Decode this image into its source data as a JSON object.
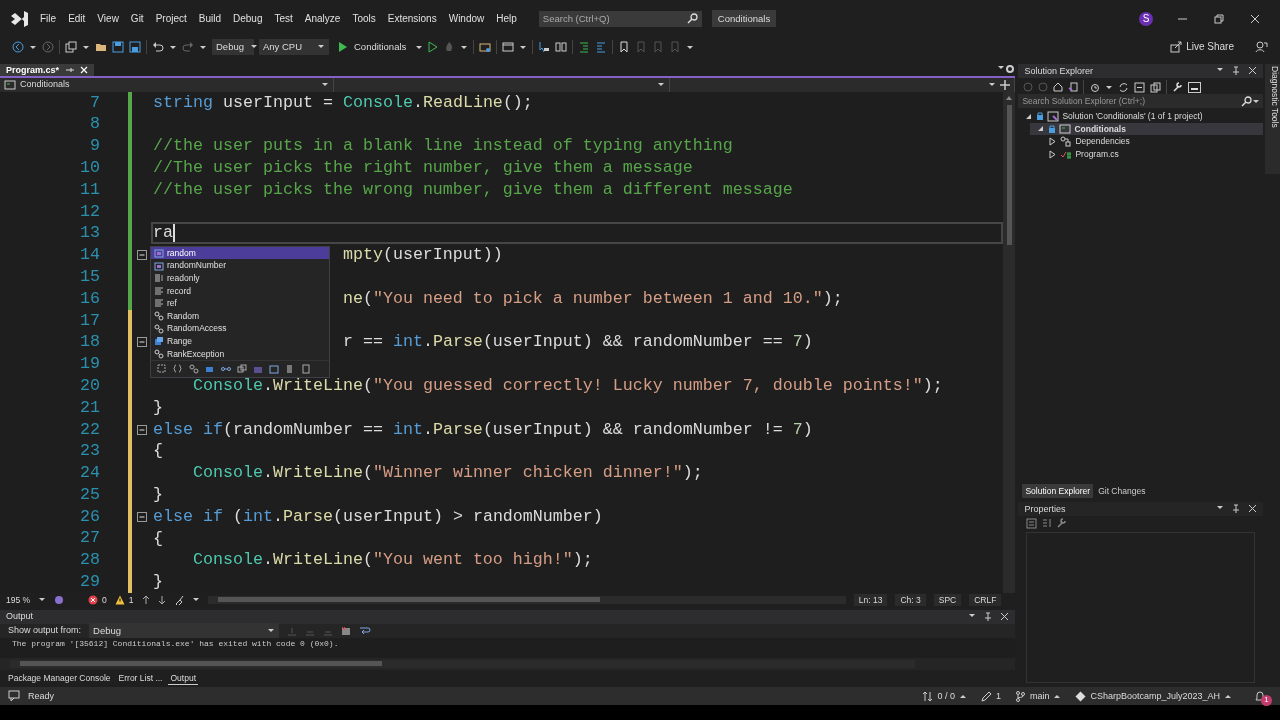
{
  "menu": {
    "items": [
      "File",
      "Edit",
      "View",
      "Git",
      "Project",
      "Build",
      "Debug",
      "Test",
      "Analyze",
      "Tools",
      "Extensions",
      "Window",
      "Help"
    ],
    "search": {
      "placeholder": "Search (Ctrl+Q)"
    },
    "solution_name": "Conditionals",
    "avatar": "S"
  },
  "toolbar": {
    "configuration": "Debug",
    "platform": "Any CPU",
    "run_target": "Conditionals",
    "live_share": "Live Share"
  },
  "document_tabs": [
    {
      "label": "Program.cs*",
      "selected": true
    }
  ],
  "navigation_bar": {
    "project": "Conditionals"
  },
  "editor": {
    "lines": [
      {
        "number": "7",
        "saved": true,
        "fold": false,
        "covered": false,
        "current": false,
        "segments": [
          {
            "kind": "kw",
            "text": "string"
          },
          {
            "kind": "plain",
            "text": " userInput = "
          },
          {
            "kind": "type",
            "text": "Console"
          },
          {
            "kind": "plain",
            "text": "."
          },
          {
            "kind": "method",
            "text": "ReadLine"
          },
          {
            "kind": "plain",
            "text": "();"
          }
        ]
      },
      {
        "number": "8",
        "saved": true,
        "fold": false,
        "covered": false,
        "current": false
      },
      {
        "number": "9",
        "saved": true,
        "fold": false,
        "covered": false,
        "current": false,
        "segments": [
          {
            "kind": "comment",
            "text": "//the user puts in a blank line instead of typing anything"
          }
        ]
      },
      {
        "number": "10",
        "saved": true,
        "fold": false,
        "covered": false,
        "current": false,
        "segments": [
          {
            "kind": "comment",
            "text": "//The user picks the right number, give them a message"
          }
        ]
      },
      {
        "number": "11",
        "saved": true,
        "fold": false,
        "covered": false,
        "current": false,
        "segments": [
          {
            "kind": "comment",
            "text": "//the user picks the wrong number, give them a different message"
          }
        ]
      },
      {
        "number": "12",
        "saved": true,
        "fold": false,
        "covered": false,
        "current": false
      },
      {
        "number": "13",
        "saved": true,
        "fold": false,
        "covered": false,
        "current": true,
        "segments": [
          {
            "kind": "plain",
            "text": "ra"
          }
        ]
      },
      {
        "number": "14",
        "saved": true,
        "fold": true,
        "covered": true,
        "current": false,
        "segments": [
          {
            "kind": "method",
            "text": "mpty"
          },
          {
            "kind": "plain",
            "text": "(userInput))"
          }
        ]
      },
      {
        "number": "15",
        "saved": true,
        "fold": false,
        "current": false
      },
      {
        "number": "16",
        "saved": true,
        "fold": false,
        "covered": true,
        "current": false,
        "segments": [
          {
            "kind": "method",
            "text": "ne"
          },
          {
            "kind": "plain",
            "text": "("
          },
          {
            "kind": "string",
            "text": "\"You need to pick a number between 1 and 10.\""
          },
          {
            "kind": "plain",
            "text": ");"
          }
        ]
      },
      {
        "number": "17",
        "saved": false,
        "fold": false,
        "current": false
      },
      {
        "number": "18",
        "saved": false,
        "fold": true,
        "covered": true,
        "current": false,
        "segments": [
          {
            "kind": "plain",
            "text": "r == "
          },
          {
            "kind": "kw",
            "text": "int"
          },
          {
            "kind": "plain",
            "text": "."
          },
          {
            "kind": "method",
            "text": "Parse"
          },
          {
            "kind": "plain",
            "text": "(userInput) && randomNumber == "
          },
          {
            "kind": "num",
            "text": "7"
          },
          {
            "kind": "plain",
            "text": ")"
          }
        ]
      },
      {
        "number": "19",
        "saved": false,
        "fold": false,
        "current": false
      },
      {
        "number": "20",
        "saved": false,
        "fold": false,
        "covered": false,
        "current": false,
        "segments": [
          {
            "kind": "type",
            "text": "    Console"
          },
          {
            "kind": "plain",
            "text": "."
          },
          {
            "kind": "method",
            "text": "WriteLine"
          },
          {
            "kind": "plain",
            "text": "("
          },
          {
            "kind": "string",
            "text": "\"You guessed correctly! Lucky number 7, double points!\""
          },
          {
            "kind": "plain",
            "text": ");"
          }
        ]
      },
      {
        "number": "21",
        "saved": false,
        "fold": false,
        "covered": false,
        "current": false,
        "segments": [
          {
            "kind": "plain",
            "text": "}"
          }
        ]
      },
      {
        "number": "22",
        "saved": false,
        "fold": true,
        "covered": false,
        "current": false,
        "segments": [
          {
            "kind": "kw",
            "text": "else if"
          },
          {
            "kind": "plain",
            "text": "(randomNumber == "
          },
          {
            "kind": "kw",
            "text": "int"
          },
          {
            "kind": "plain",
            "text": "."
          },
          {
            "kind": "method",
            "text": "Parse"
          },
          {
            "kind": "plain",
            "text": "(userInput) && randomNumber != "
          },
          {
            "kind": "num",
            "text": "7"
          },
          {
            "kind": "plain",
            "text": ")"
          }
        ]
      },
      {
        "number": "23",
        "saved": false,
        "fold": false,
        "covered": false,
        "current": false,
        "segments": [
          {
            "kind": "plain",
            "text": "{"
          }
        ]
      },
      {
        "number": "24",
        "saved": false,
        "fold": false,
        "covered": false,
        "current": false,
        "segments": [
          {
            "kind": "type",
            "text": "    Console"
          },
          {
            "kind": "plain",
            "text": "."
          },
          {
            "kind": "method",
            "text": "WriteLine"
          },
          {
            "kind": "plain",
            "text": "("
          },
          {
            "kind": "string",
            "text": "\"Winner winner chicken dinner!\""
          },
          {
            "kind": "plain",
            "text": ");"
          }
        ]
      },
      {
        "number": "25",
        "saved": false,
        "fold": false,
        "covered": false,
        "current": false,
        "segments": [
          {
            "kind": "plain",
            "text": "}"
          }
        ]
      },
      {
        "number": "26",
        "saved": false,
        "fold": true,
        "covered": false,
        "current": false,
        "segments": [
          {
            "kind": "kw",
            "text": "else if"
          },
          {
            "kind": "plain",
            "text": " ("
          },
          {
            "kind": "kw",
            "text": "int"
          },
          {
            "kind": "plain",
            "text": "."
          },
          {
            "kind": "method",
            "text": "Parse"
          },
          {
            "kind": "plain",
            "text": "(userInput) > randomNumber)"
          }
        ]
      },
      {
        "number": "27",
        "saved": false,
        "fold": false,
        "covered": false,
        "current": false,
        "segments": [
          {
            "kind": "plain",
            "text": "{"
          }
        ]
      },
      {
        "number": "28",
        "saved": false,
        "fold": false,
        "covered": false,
        "current": false,
        "segments": [
          {
            "kind": "type",
            "text": "    Console"
          },
          {
            "kind": "plain",
            "text": "."
          },
          {
            "kind": "method",
            "text": "WriteLine"
          },
          {
            "kind": "plain",
            "text": "("
          },
          {
            "kind": "string",
            "text": "\"You went too high!\""
          },
          {
            "kind": "plain",
            "text": ");"
          }
        ]
      },
      {
        "number": "29",
        "saved": false,
        "fold": false,
        "covered": false,
        "current": false,
        "segments": [
          {
            "kind": "plain",
            "text": "}"
          }
        ]
      }
    ],
    "completion": {
      "items": [
        {
          "label": "random",
          "kind": "variable",
          "selected": true
        },
        {
          "label": "randomNumber",
          "kind": "variable",
          "selected": false
        },
        {
          "label": "readonly",
          "kind": "modifier",
          "selected": false
        },
        {
          "label": "record",
          "kind": "keyword",
          "selected": false
        },
        {
          "label": "ref",
          "kind": "keyword",
          "selected": false
        },
        {
          "label": "Random",
          "kind": "class",
          "selected": false
        },
        {
          "label": "RandomAccess",
          "kind": "class",
          "selected": false
        },
        {
          "label": "Range",
          "kind": "struct",
          "selected": false
        },
        {
          "label": "RankException",
          "kind": "class",
          "selected": false
        }
      ]
    }
  },
  "editor_status": {
    "zoom": "195 %",
    "errors": "0",
    "warnings": "1",
    "line": "Ln: 13",
    "column": "Ch: 3",
    "indent": "SPC",
    "line_ending": "CRLF"
  },
  "output": {
    "title": "Output",
    "source_label": "Show output from:",
    "source": "Debug",
    "text": "The program '[35612] Conditionals.exe' has exited with code 0 (0x0).",
    "tabs": [
      {
        "label": "Package Manager Console",
        "selected": false
      },
      {
        "label": "Error List ...",
        "selected": false
      },
      {
        "label": "Output",
        "selected": true
      }
    ]
  },
  "solution_explorer": {
    "title": "Solution Explorer",
    "search": {
      "placeholder": "Search Solution Explorer (Ctrl+;)"
    },
    "tree": [
      {
        "label": "Solution 'Conditionals' (1 of 1 project)",
        "kind": "solution",
        "expanded": true,
        "selected": false,
        "children": [
          {
            "label": "Conditionals",
            "kind": "project",
            "expanded": true,
            "selected": true,
            "children": [
              {
                "label": "Dependencies",
                "kind": "dependencies",
                "expanded": false,
                "selected": false
              },
              {
                "label": "Program.cs",
                "kind": "file",
                "expanded": false,
                "selected": false
              }
            ]
          }
        ]
      }
    ],
    "tabs": [
      {
        "label": "Solution Explorer",
        "selected": true
      },
      {
        "label": "Git Changes",
        "selected": false
      }
    ]
  },
  "properties": {
    "title": "Properties"
  },
  "side_tab": "Diagnostic Tools",
  "status_bar": {
    "message": "Ready",
    "changes": "0 / 0",
    "edits": "1",
    "branch": "main",
    "repository": "CSharpBootcamp_July2023_AH",
    "notifications": "1"
  }
}
